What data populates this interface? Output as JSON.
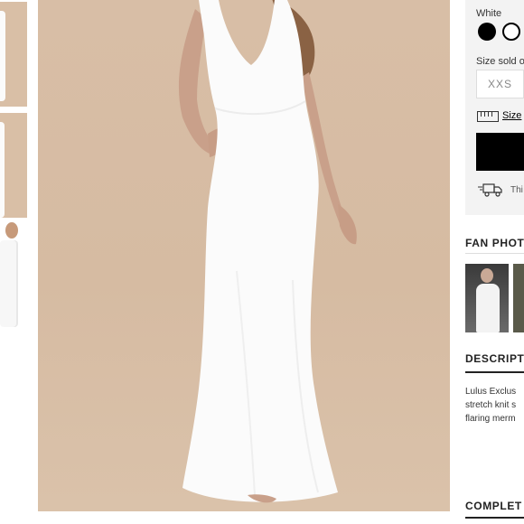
{
  "product": {
    "color_label": "White",
    "swatches": [
      "black-swatch",
      "white-swatch"
    ],
    "size_label": "Size sold o",
    "size_option": "XXS",
    "size_guide_link": "Size",
    "shipping_text": "Thi"
  },
  "sections": {
    "fan_photos_heading": "FAN PHOT",
    "description_heading": "DESCRIPT",
    "description_lines": [
      "Lulus Exclus",
      "stretch knit s",
      "flaring merm"
    ],
    "complete_heading": "COMPLET"
  },
  "colors": {
    "backdrop": "#d8bea6",
    "dress": "#fbfbfb",
    "button": "#000000"
  }
}
